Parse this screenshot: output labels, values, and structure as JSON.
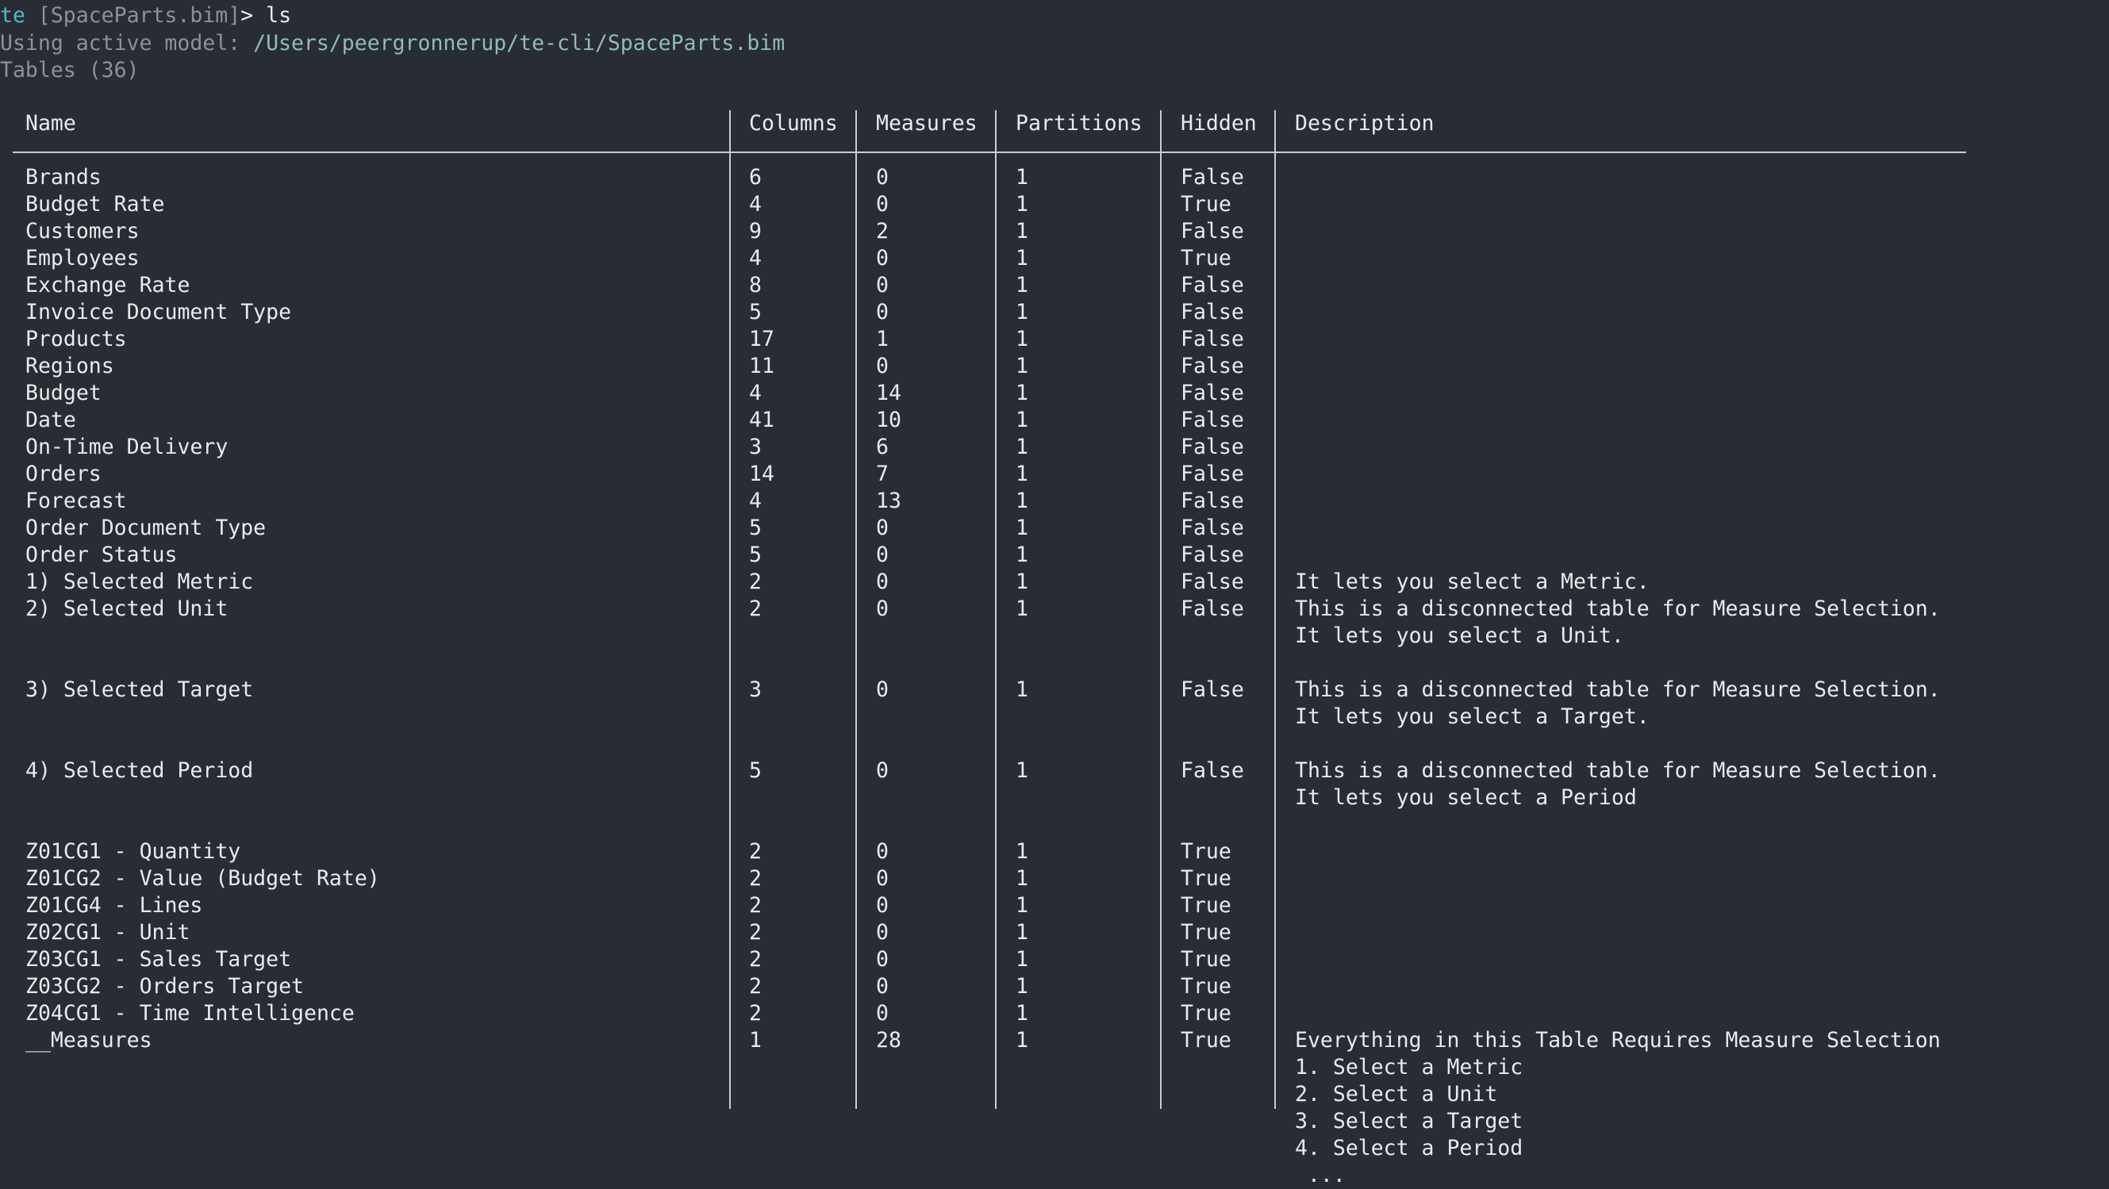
{
  "prompt": {
    "app": "te",
    "model_file": "[SpaceParts.bim]",
    "symbol": ">",
    "command": "ls"
  },
  "status": {
    "using_label": "Using active model:",
    "model_path": "/Users/peergronnerup/te-cli/SpaceParts.bim",
    "tables_count": "Tables (36)"
  },
  "columns": {
    "name": "Name",
    "columns": "Columns",
    "measures": "Measures",
    "partitions": "Partitions",
    "hidden": "Hidden",
    "description": "Description"
  },
  "rows": [
    {
      "name": "Brands",
      "columns": "6",
      "measures": "0",
      "partitions": "1",
      "hidden": "False",
      "description": []
    },
    {
      "name": "Budget Rate",
      "columns": "4",
      "measures": "0",
      "partitions": "1",
      "hidden": "True",
      "description": []
    },
    {
      "name": "Customers",
      "columns": "9",
      "measures": "2",
      "partitions": "1",
      "hidden": "False",
      "description": []
    },
    {
      "name": "Employees",
      "columns": "4",
      "measures": "0",
      "partitions": "1",
      "hidden": "True",
      "description": []
    },
    {
      "name": "Exchange Rate",
      "columns": "8",
      "measures": "0",
      "partitions": "1",
      "hidden": "False",
      "description": []
    },
    {
      "name": "Invoice Document Type",
      "columns": "5",
      "measures": "0",
      "partitions": "1",
      "hidden": "False",
      "description": []
    },
    {
      "name": "Products",
      "columns": "17",
      "measures": "1",
      "partitions": "1",
      "hidden": "False",
      "description": []
    },
    {
      "name": "Regions",
      "columns": "11",
      "measures": "0",
      "partitions": "1",
      "hidden": "False",
      "description": []
    },
    {
      "name": "Budget",
      "columns": "4",
      "measures": "14",
      "partitions": "1",
      "hidden": "False",
      "description": []
    },
    {
      "name": "Date",
      "columns": "41",
      "measures": "10",
      "partitions": "1",
      "hidden": "False",
      "description": []
    },
    {
      "name": "On-Time Delivery",
      "columns": "3",
      "measures": "6",
      "partitions": "1",
      "hidden": "False",
      "description": []
    },
    {
      "name": "Orders",
      "columns": "14",
      "measures": "7",
      "partitions": "1",
      "hidden": "False",
      "description": []
    },
    {
      "name": "Forecast",
      "columns": "4",
      "measures": "13",
      "partitions": "1",
      "hidden": "False",
      "description": []
    },
    {
      "name": "Order Document Type",
      "columns": "5",
      "measures": "0",
      "partitions": "1",
      "hidden": "False",
      "description": []
    },
    {
      "name": "Order Status",
      "columns": "5",
      "measures": "0",
      "partitions": "1",
      "hidden": "False",
      "description": []
    },
    {
      "name": "1) Selected Metric",
      "columns": "2",
      "measures": "0",
      "partitions": "1",
      "hidden": "False",
      "description": [
        "It lets you select a Metric."
      ]
    },
    {
      "name": "2) Selected Unit",
      "columns": "2",
      "measures": "0",
      "partitions": "1",
      "hidden": "False",
      "description": [
        "This is a disconnected table for Measure Selection.",
        "It lets you select a Unit.",
        ""
      ]
    },
    {
      "name": "3) Selected Target",
      "columns": "3",
      "measures": "0",
      "partitions": "1",
      "hidden": "False",
      "description": [
        "This is a disconnected table for Measure Selection.",
        "It lets you select a Target.",
        ""
      ]
    },
    {
      "name": "4) Selected Period",
      "columns": "5",
      "measures": "0",
      "partitions": "1",
      "hidden": "False",
      "description": [
        "This is a disconnected table for Measure Selection.",
        "It lets you select a Period",
        ""
      ]
    },
    {
      "name": "Z01CG1 - Quantity",
      "columns": "2",
      "measures": "0",
      "partitions": "1",
      "hidden": "True",
      "description": []
    },
    {
      "name": "Z01CG2 - Value (Budget Rate)",
      "columns": "2",
      "measures": "0",
      "partitions": "1",
      "hidden": "True",
      "description": []
    },
    {
      "name": "Z01CG4 - Lines",
      "columns": "2",
      "measures": "0",
      "partitions": "1",
      "hidden": "True",
      "description": []
    },
    {
      "name": "Z02CG1 - Unit",
      "columns": "2",
      "measures": "0",
      "partitions": "1",
      "hidden": "True",
      "description": []
    },
    {
      "name": "Z03CG1 - Sales Target",
      "columns": "2",
      "measures": "0",
      "partitions": "1",
      "hidden": "True",
      "description": []
    },
    {
      "name": "Z03CG2 - Orders Target",
      "columns": "2",
      "measures": "0",
      "partitions": "1",
      "hidden": "True",
      "description": []
    },
    {
      "name": "Z04CG1 - Time Intelligence",
      "columns": "2",
      "measures": "0",
      "partitions": "1",
      "hidden": "True",
      "description": []
    },
    {
      "name": "__Measures",
      "columns": "1",
      "measures": "28",
      "partitions": "1",
      "hidden": "True",
      "description": [
        "Everything in this Table Requires Measure Selection",
        "1. Select a Metric",
        "2. Select a Unit",
        "3. Select a Target",
        "4. Select a Period",
        " ..."
      ]
    }
  ],
  "colors": {
    "background": "#282c34",
    "text": "#eaeaea",
    "prompt_accent": "#56b6c2",
    "dim_text": "#8b929c",
    "path_text": "#8fbcbb"
  }
}
